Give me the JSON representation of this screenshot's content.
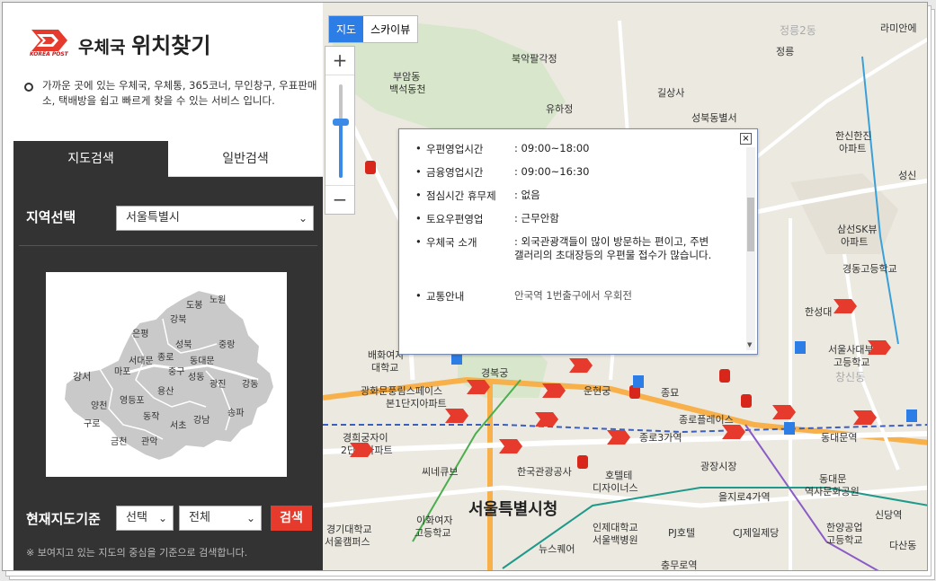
{
  "logo": {
    "brand": "KOREA POST",
    "title_prefix": "우체국",
    "title_main": "위치찾기"
  },
  "description": "가까운 곳에 있는 우체국, 우체통, 365코너, 무인창구, 우표판매소, 택배방을 쉽고 빠르게 찾을 수 있는 서비스 입니다.",
  "tabs": [
    {
      "label": "지도검색"
    },
    {
      "label": "일반검색"
    }
  ],
  "region": {
    "label": "지역선택",
    "value": "서울특별시"
  },
  "districts": [
    "도봉",
    "노원",
    "강북",
    "은평",
    "성북",
    "중랑",
    "종로",
    "동대문",
    "서대문",
    "마포",
    "중구",
    "성동",
    "광진",
    "강동",
    "강서",
    "용산",
    "양천",
    "영등포",
    "동작",
    "구로",
    "서초",
    "강남",
    "송파",
    "금천",
    "관악"
  ],
  "current": {
    "label": "현재지도기준",
    "select1": "선택",
    "select2": "전체",
    "button": "검색"
  },
  "note": "※ 보여지고 있는 지도의 중심을 기준으로 검색합니다.",
  "map": {
    "type_map": "지도",
    "type_sky": "스카이뷰",
    "zoom_level": 0.6,
    "labels": [
      "북악팔각정",
      "길상사",
      "유하정",
      "성북동별서",
      "부암동",
      "백석동천",
      "정릉",
      "정릉2동",
      "라미안에",
      "한신한진",
      "아파트",
      "삼선SK뷰",
      "아파트",
      "경동고등학교",
      "한성대",
      "서울사대부",
      "고등학교",
      "창신동",
      "배화여자",
      "대학교",
      "경복궁",
      "광화문풍림스페이스",
      "본1단지아파트",
      "운현궁",
      "종묘",
      "종로플레이스",
      "종로3가역",
      "동대문역",
      "씨네큐브",
      "한국관광공사",
      "호텔테",
      "디자이너스",
      "광장시장",
      "을지로4가역",
      "서울특별시청",
      "이화여자",
      "고등학교",
      "인제대학교",
      "서울백병원",
      "PJ호텔",
      "CJ제일제당",
      "동대문",
      "역사문화공원",
      "한양공업",
      "고등학교",
      "경기대학교",
      "서울캠퍼스",
      "뉴스퀘어",
      "충무로역",
      "신당역",
      "다산동",
      "경희궁자이",
      "2단지아파트",
      "성신"
    ]
  },
  "popup": {
    "close": "×",
    "rows": [
      {
        "k": "우편영업시간",
        "v": ": 09:00~18:00"
      },
      {
        "k": "금융영업시간",
        "v": ": 09:00~16:30"
      },
      {
        "k": "점심시간 휴무제",
        "v": ": 없음"
      },
      {
        "k": "토요우편영업",
        "v": ": 근무안함"
      },
      {
        "k": "우체국 소개",
        "v": ": 외국관광객들이 많이 방문하는 편이고, 주변 갤러리의 초대장등의 우편물 접수가 많습니다."
      },
      {
        "k": "교통안내",
        "v": "안국역 1번출구에서 우회전"
      }
    ]
  },
  "colors": {
    "accent": "#2d7de6",
    "post_red": "#e53a2c",
    "dark": "#333333"
  }
}
